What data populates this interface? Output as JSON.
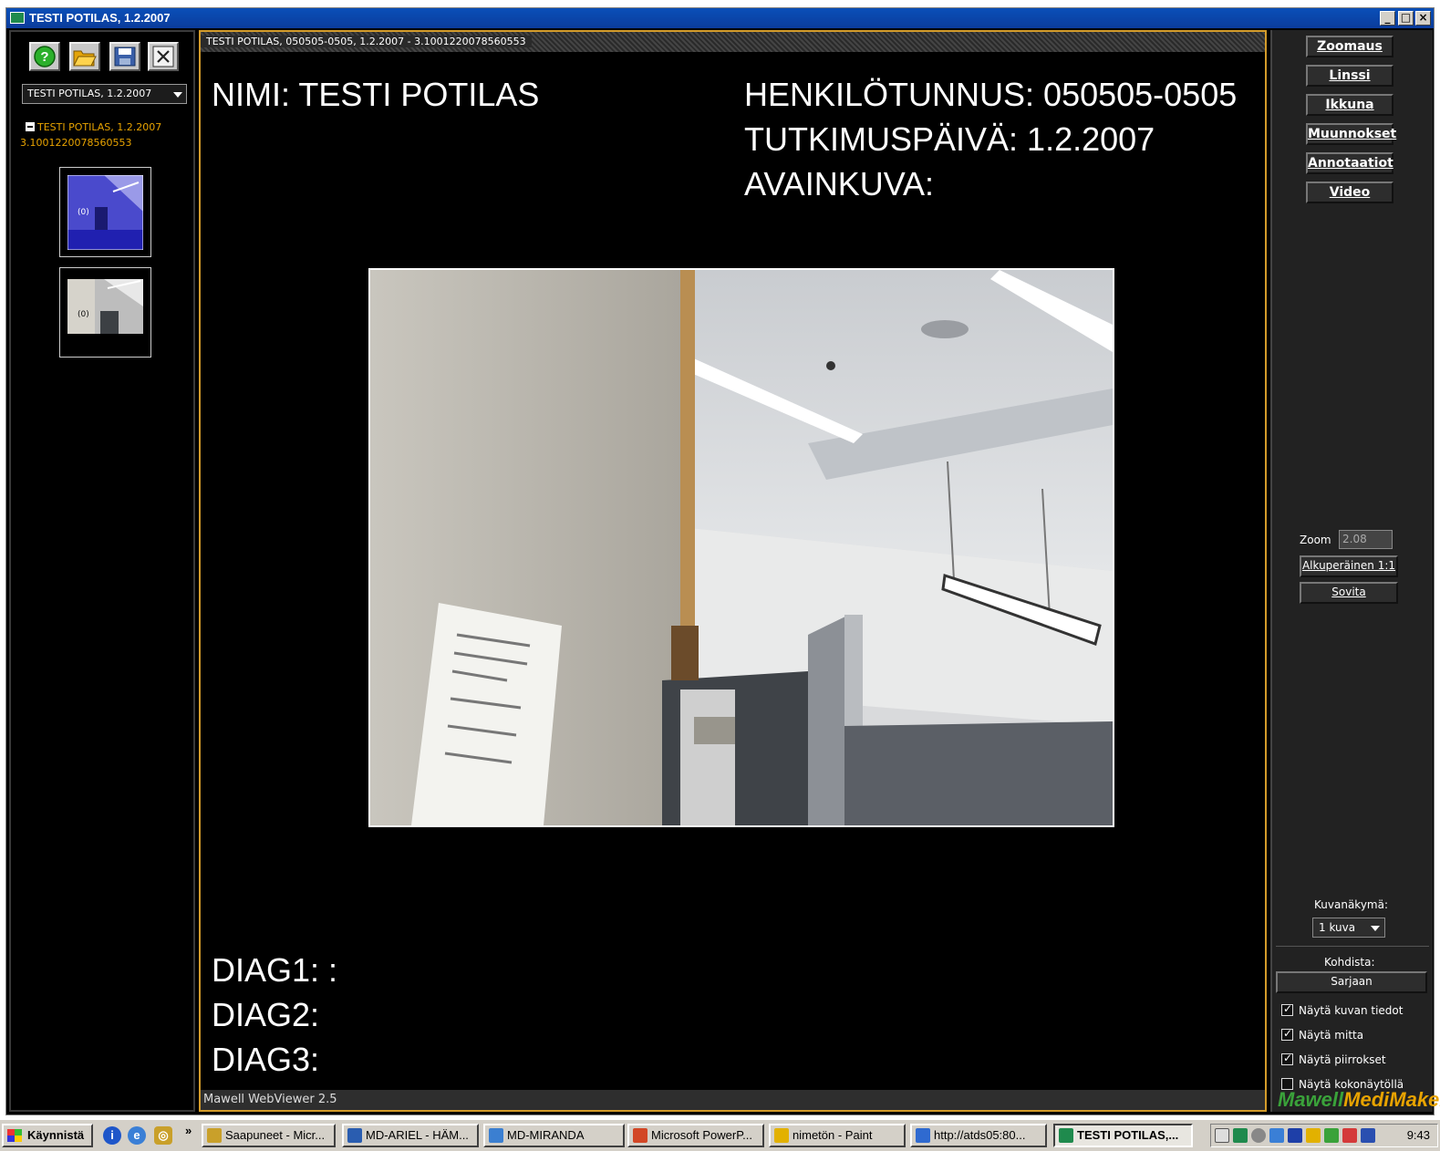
{
  "window": {
    "title": "TESTI POTILAS, 1.2.2007",
    "controls": {
      "minimize": "_",
      "maximize": "□",
      "close": "×"
    }
  },
  "left_panel": {
    "toolbar": [
      {
        "name": "help-icon",
        "glyph": "?"
      },
      {
        "name": "folder-open-icon",
        "glyph": ""
      },
      {
        "name": "save-icon",
        "glyph": ""
      },
      {
        "name": "close-icon",
        "glyph": "✕"
      }
    ],
    "study_select": "TESTI POTILAS, 1.2.2007",
    "tree": {
      "label_line1": "TESTI POTILAS, 1.2.2007",
      "label_line2": "3.1001220078560553"
    },
    "thumbnails": [
      {
        "label": "(0)",
        "selected": true
      },
      {
        "label": "(0)",
        "selected": false
      }
    ]
  },
  "viewer": {
    "header": "TESTI POTILAS, 050505-0505, 1.2.2007 - 3.1001220078560553",
    "name_line": "NIMI: TESTI POTILAS",
    "id_line": "HENKILÖTUNNUS: 050505-0505",
    "date_line": "TUTKIMUSPÄIVÄ: 1.2.2007",
    "keyimage_line": "AVAINKUVA:",
    "diag1": "DIAG1: :",
    "diag2": "DIAG2:",
    "diag3": "DIAG3:",
    "footer": "Mawell WebViewer 2.5"
  },
  "right_panel": {
    "tabs": [
      "Zoomaus",
      "Linssi",
      "Ikkuna",
      "Muunnokset",
      "Annotaatiot",
      "Video"
    ],
    "zoom_label": "Zoom",
    "zoom_value": "2.08",
    "original_button": "Alkuperäinen 1:1",
    "fit_button": "Sovita",
    "view_label": "Kuvanäkymä:",
    "view_value": "1 kuva",
    "target_label": "Kohdista:",
    "target_button": "Sarjaan",
    "checkboxes": [
      {
        "label": "Näytä kuvan tiedot",
        "checked": true
      },
      {
        "label": "Näytä mitta",
        "checked": true
      },
      {
        "label": "Näytä piirrokset",
        "checked": true
      },
      {
        "label": "Näytä kokonäytöllä",
        "checked": false
      }
    ],
    "brand_part1": "Mawell",
    "brand_part2": "MediMaker"
  },
  "taskbar": {
    "start": "Käynnistä",
    "chevron": "»",
    "tasks": [
      {
        "label": "Saapuneet - Micr...",
        "icon_color": "#c9a02a",
        "active": false
      },
      {
        "label": "MD-ARIEL - HÄM...",
        "icon_color": "#2a5db0",
        "active": false
      },
      {
        "label": "MD-MIRANDA",
        "icon_color": "#3b7fd1",
        "active": false
      },
      {
        "label": "Microsoft PowerP...",
        "icon_color": "#d24726",
        "active": false
      },
      {
        "label": "nimetön - Paint",
        "icon_color": "#e2b100",
        "active": false
      },
      {
        "label": "http://atds05:80...",
        "icon_color": "#2f6ad0",
        "active": false
      },
      {
        "label": "TESTI POTILAS,...",
        "icon_color": "#1f8a4d",
        "active": true
      }
    ],
    "clock": "9:43"
  }
}
